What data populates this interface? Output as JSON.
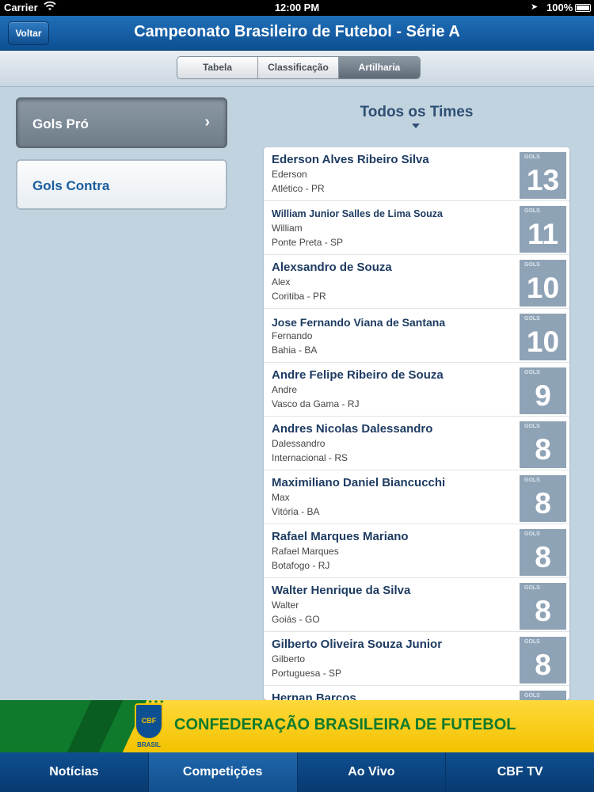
{
  "status": {
    "carrier": "Carrier",
    "time": "12:00 PM",
    "battery": "100%"
  },
  "nav": {
    "back_label": "Voltar",
    "title": "Campeonato Brasileiro de Futebol - Série A"
  },
  "segments": [
    "Tabela",
    "Classificação",
    "Artilharia"
  ],
  "active_segment": "Artilharia",
  "menu": {
    "items": [
      {
        "label": "Gols Pró",
        "selected": true
      },
      {
        "label": "Gols Contra",
        "selected": false
      }
    ]
  },
  "panel": {
    "filter_label": "Todos os Times",
    "goals_label": "GOLS",
    "scorers": [
      {
        "name": "Ederson Alves Ribeiro Silva",
        "nickname": "Ederson",
        "team": "Atlético - PR",
        "goals": "13"
      },
      {
        "name": "William Junior Salles de Lima Souza",
        "nickname": "William",
        "team": "Ponte Preta - SP",
        "goals": "11"
      },
      {
        "name": "Alexsandro de Souza",
        "nickname": "Alex",
        "team": "Coritiba - PR",
        "goals": "10"
      },
      {
        "name": "Jose Fernando Viana de Santana",
        "nickname": "Fernando",
        "team": "Bahia - BA",
        "goals": "10"
      },
      {
        "name": "Andre Felipe Ribeiro de Souza",
        "nickname": "Andre",
        "team": "Vasco da Gama - RJ",
        "goals": "9"
      },
      {
        "name": "Andres Nicolas Dalessandro",
        "nickname": "Dalessandro",
        "team": "Internacional - RS",
        "goals": "8"
      },
      {
        "name": "Maximiliano Daniel Biancucchi",
        "nickname": "Max",
        "team": "Vitória - BA",
        "goals": "8"
      },
      {
        "name": "Rafael Marques Mariano",
        "nickname": "Rafael Marques",
        "team": "Botafogo - RJ",
        "goals": "8"
      },
      {
        "name": "Walter Henrique da Silva",
        "nickname": "Walter",
        "team": "Goiás - GO",
        "goals": "8"
      },
      {
        "name": "Gilberto Oliveira Souza Junior",
        "nickname": "Gilberto",
        "team": "Portuguesa - SP",
        "goals": "8"
      },
      {
        "name": "Hernan Barcos",
        "nickname": "",
        "team": "",
        "goals": ""
      }
    ]
  },
  "banner": {
    "org_name": "CONFEDERAÇÃO BRASILEIRA DE FUTEBOL",
    "crest_text": "CBF",
    "crest_caption": "BRASIL"
  },
  "tabs": [
    "Notícias",
    "Competições",
    "Ao Vivo",
    "CBF TV"
  ],
  "active_tab": "Competições"
}
